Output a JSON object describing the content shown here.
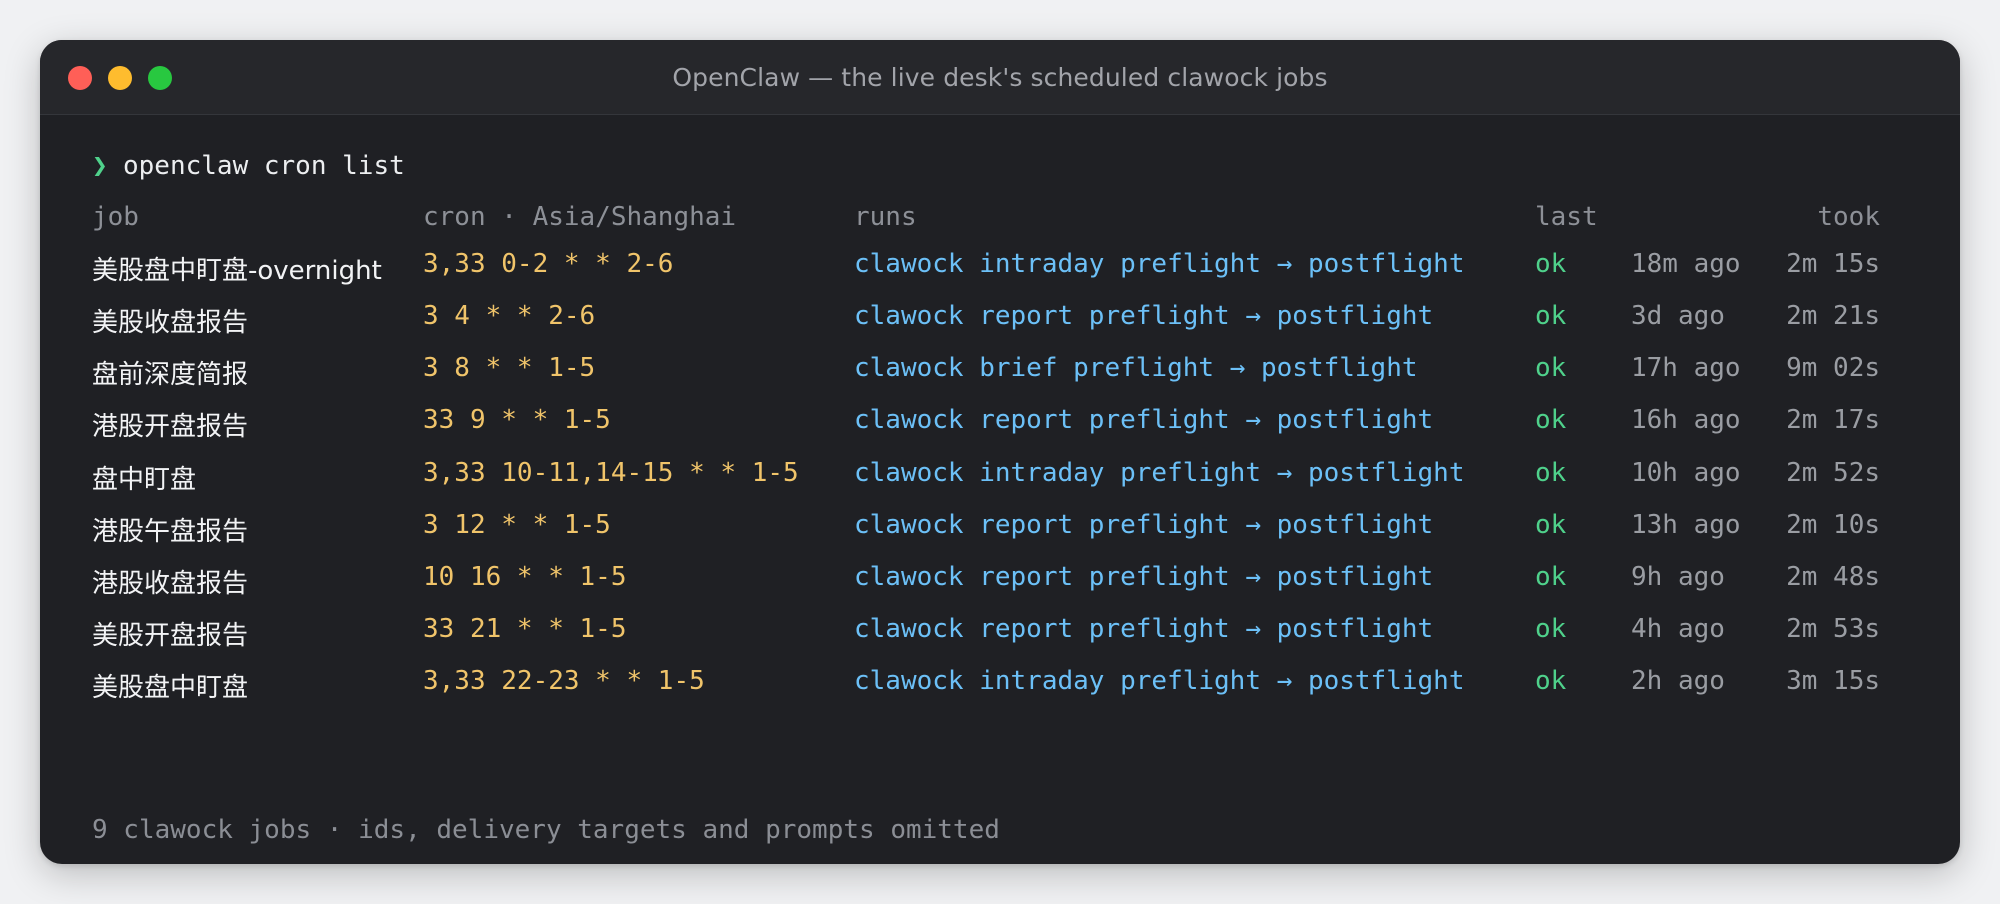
{
  "window": {
    "title": "OpenClaw — the live desk's scheduled clawock jobs"
  },
  "terminal": {
    "prompt_symbol": "❯",
    "command": "openclaw cron list",
    "headers": {
      "job": "job",
      "cron": "cron · Asia/Shanghai",
      "runs": "runs",
      "last": "last",
      "took": "took"
    },
    "rows": [
      {
        "job": "美股盘中盯盘-overnight",
        "cron": "3,33 0-2 * * 2-6",
        "runs": "clawock intraday preflight → postflight",
        "status": "ok",
        "last": "18m ago",
        "took": "2m 15s"
      },
      {
        "job": "美股收盘报告",
        "cron": "3 4 * * 2-6",
        "runs": "clawock report preflight → postflight",
        "status": "ok",
        "last": "3d ago",
        "took": "2m 21s"
      },
      {
        "job": "盘前深度简报",
        "cron": "3 8 * * 1-5",
        "runs": "clawock brief preflight → postflight",
        "status": "ok",
        "last": "17h ago",
        "took": "9m 02s"
      },
      {
        "job": "港股开盘报告",
        "cron": "33 9 * * 1-5",
        "runs": "clawock report preflight → postflight",
        "status": "ok",
        "last": "16h ago",
        "took": "2m 17s"
      },
      {
        "job": "盘中盯盘",
        "cron": "3,33 10-11,14-15 * * 1-5",
        "runs": "clawock intraday preflight → postflight",
        "status": "ok",
        "last": "10h ago",
        "took": "2m 52s"
      },
      {
        "job": "港股午盘报告",
        "cron": "3 12 * * 1-5",
        "runs": "clawock report preflight → postflight",
        "status": "ok",
        "last": "13h ago",
        "took": "2m 10s"
      },
      {
        "job": "港股收盘报告",
        "cron": "10 16 * * 1-5",
        "runs": "clawock report preflight → postflight",
        "status": "ok",
        "last": "9h ago",
        "took": "2m 48s"
      },
      {
        "job": "美股开盘报告",
        "cron": "33 21 * * 1-5",
        "runs": "clawock report preflight → postflight",
        "status": "ok",
        "last": "4h ago",
        "took": "2m 53s"
      },
      {
        "job": "美股盘中盯盘",
        "cron": "3,33 22-23 * * 1-5",
        "runs": "clawock intraday preflight → postflight",
        "status": "ok",
        "last": "2h ago",
        "took": "3m 15s"
      }
    ],
    "footer": "9 clawock jobs · ids, delivery targets and prompts omitted"
  },
  "colors": {
    "background": "#1f2024",
    "prompt": "#4fd18b",
    "cron": "#f0c46a",
    "runs": "#6cc0f7",
    "ok": "#4fd18b",
    "muted": "#9a9da3"
  }
}
